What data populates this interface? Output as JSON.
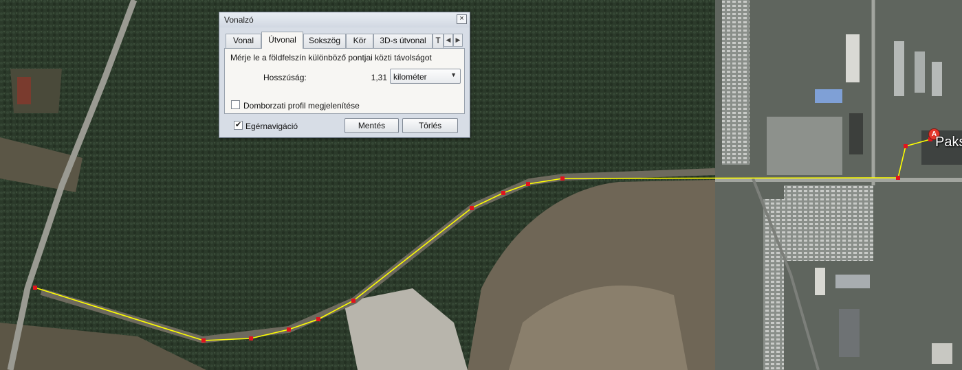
{
  "map": {
    "place_label": "Paks",
    "pin_letter": "A",
    "route_color": "#ffff00",
    "vertex_color": "#e0141e"
  },
  "dialog": {
    "title": "Vonalzó",
    "close_glyph": "×",
    "tabs": [
      {
        "label": "Vonal",
        "active": false
      },
      {
        "label": "Útvonal",
        "active": true
      },
      {
        "label": "Sokszög",
        "active": false
      },
      {
        "label": "Kör",
        "active": false
      },
      {
        "label": "3D-s útvonal",
        "active": false
      },
      {
        "label": "T",
        "active": false
      }
    ],
    "tab_scroll_left": "◀",
    "tab_scroll_right": "▶",
    "description": "Mérje le a földfelszín különböző pontjai közti távolságot",
    "length_label": "Hosszúság:",
    "length_value": "1,31",
    "unit": {
      "selected": "kilométer",
      "arrow": "▼"
    },
    "elevation_profile": {
      "label": "Domborzati profil megjelenítése",
      "checked": false
    },
    "mouse_nav": {
      "label": "Egérnavigáció",
      "checked": true,
      "check_glyph": "✔"
    },
    "save_label": "Mentés",
    "clear_label": "Törlés"
  }
}
